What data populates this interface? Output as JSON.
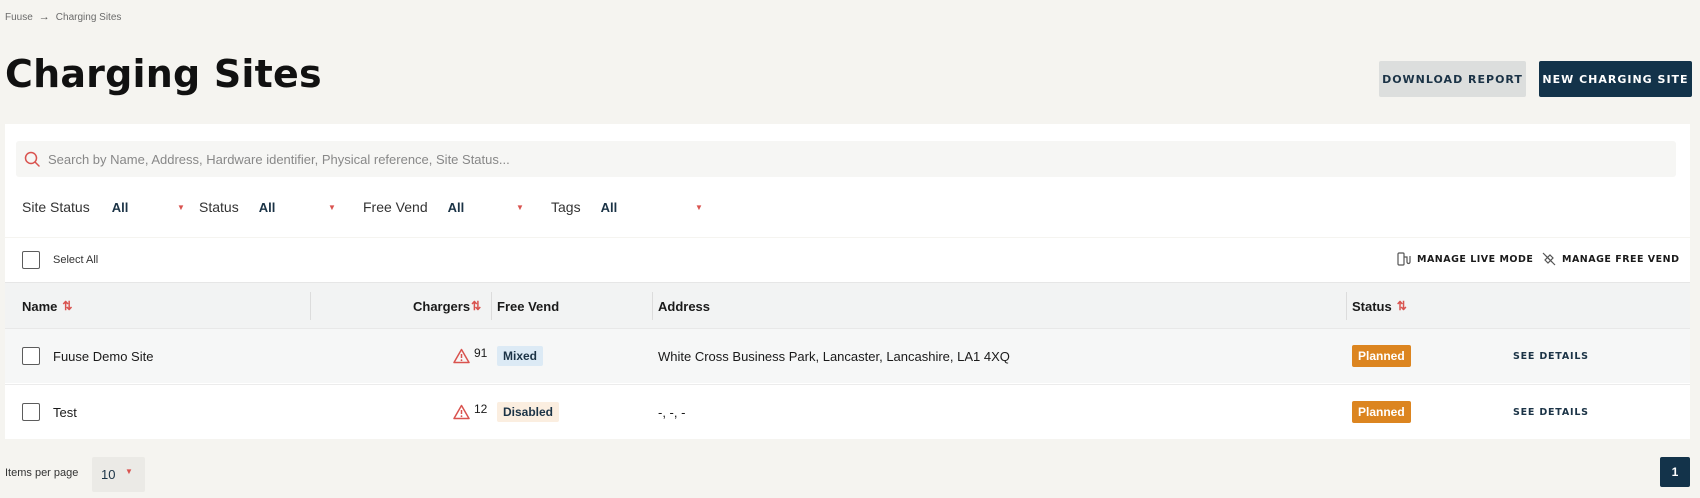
{
  "breadcrumb": {
    "root": "Fuuse",
    "current": "Charging Sites"
  },
  "page": {
    "title": "Charging Sites"
  },
  "actions": {
    "download_report": "DOWNLOAD REPORT",
    "new_site": "NEW CHARGING SITE"
  },
  "search": {
    "placeholder": "Search by Name, Address, Hardware identifier, Physical reference, Site Status..."
  },
  "filters": [
    {
      "label": "Site Status",
      "value": "All"
    },
    {
      "label": "Status",
      "value": "All"
    },
    {
      "label": "Free Vend",
      "value": "All"
    },
    {
      "label": "Tags",
      "value": "All"
    }
  ],
  "bulk": {
    "select_all": "Select All",
    "manage_live_mode": "MANAGE LIVE MODE",
    "manage_free_vend": "MANAGE FREE VEND"
  },
  "table": {
    "columns": {
      "name": "Name",
      "chargers": "Chargers",
      "free_vend": "Free Vend",
      "address": "Address",
      "status": "Status"
    },
    "rows": [
      {
        "name": "Fuuse Demo Site",
        "chargers": "91",
        "free_vend": "Mixed",
        "address": "White Cross Business Park, Lancaster, Lancashire, LA1 4XQ",
        "status": "Planned",
        "action": "SEE DETAILS"
      },
      {
        "name": "Test",
        "chargers": "12",
        "free_vend": "Disabled",
        "address": "-, -, -",
        "status": "Planned",
        "action": "SEE DETAILS"
      }
    ]
  },
  "pagination": {
    "items_per_page_label": "Items per page",
    "items_per_page": "10",
    "current_page": "1"
  },
  "colors": {
    "primary": "#13334a",
    "accent": "#d9534f",
    "planned": "#dc8520"
  }
}
